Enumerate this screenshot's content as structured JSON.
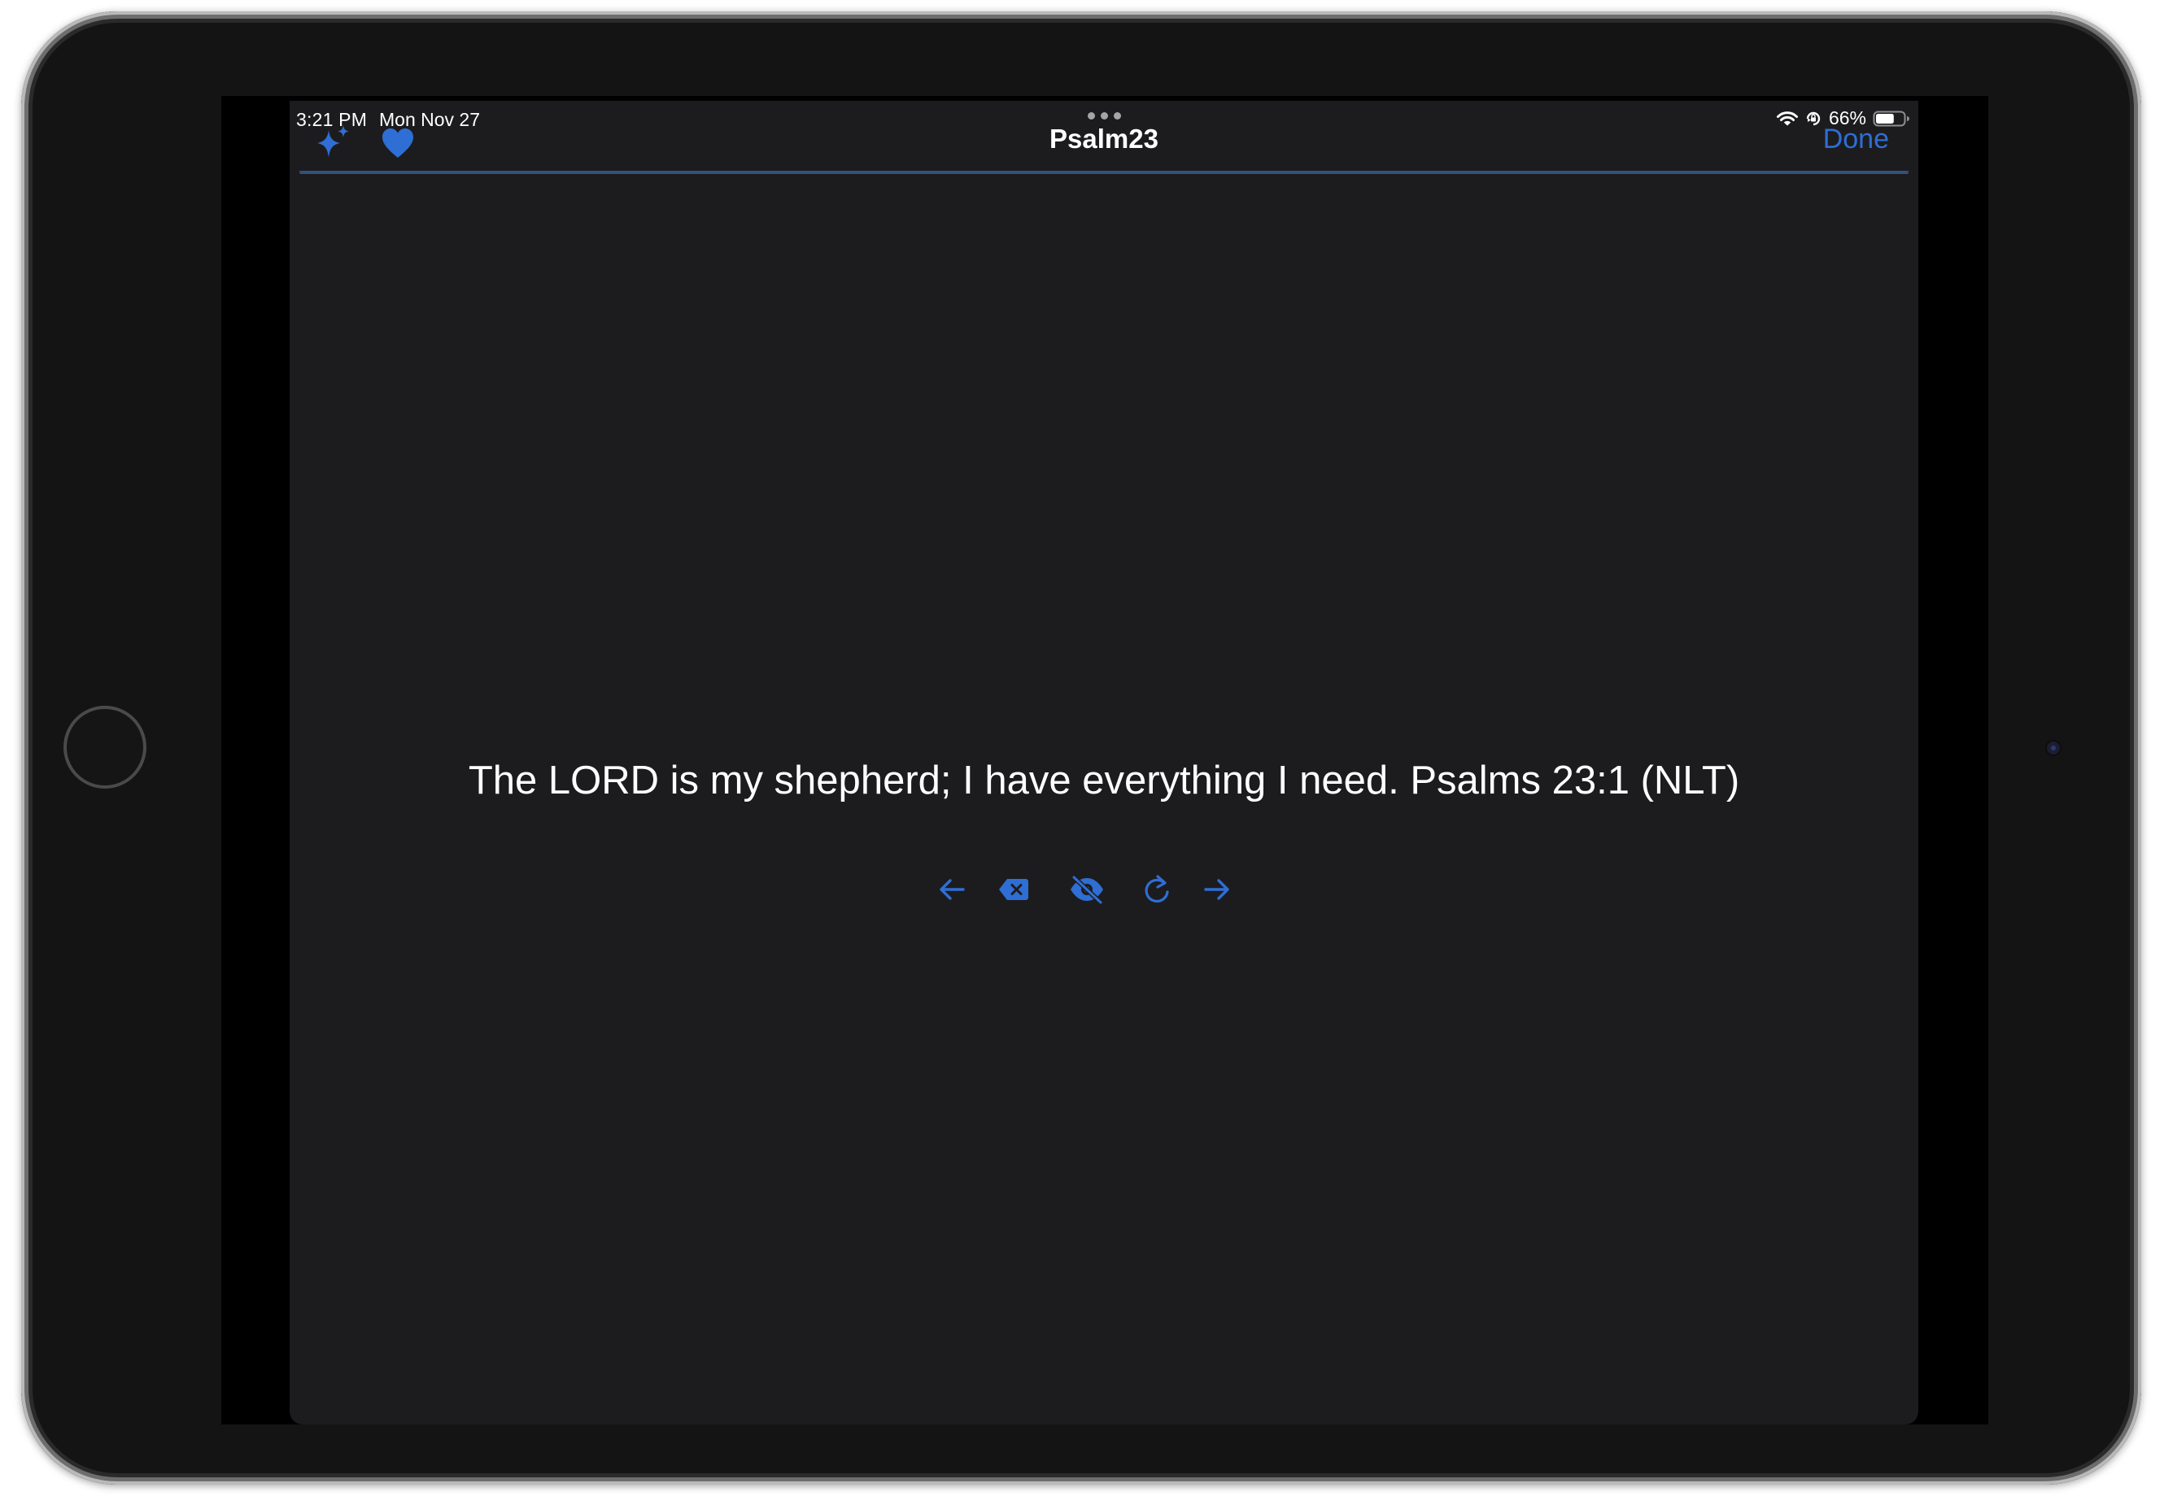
{
  "status_bar": {
    "time": "3:21 PM",
    "date": "Mon Nov 27",
    "battery_percent": "66%",
    "battery_level": 0.66,
    "icons": [
      "wifi-icon",
      "orientation-lock-icon",
      "battery-icon"
    ]
  },
  "nav": {
    "title": "Psalm23",
    "done_label": "Done",
    "left_icons": [
      "sparkles-icon",
      "heart-icon"
    ]
  },
  "verse": {
    "text": "The LORD is my shepherd; I have everything I need. Psalms 23:1 (NLT)"
  },
  "controls": [
    "arrow-left-icon",
    "delete-icon",
    "eye-slash-icon",
    "refresh-icon",
    "arrow-right-icon"
  ],
  "colors": {
    "accent": "#2f6ed4",
    "background": "#1c1c1e",
    "text": "#ffffff"
  }
}
